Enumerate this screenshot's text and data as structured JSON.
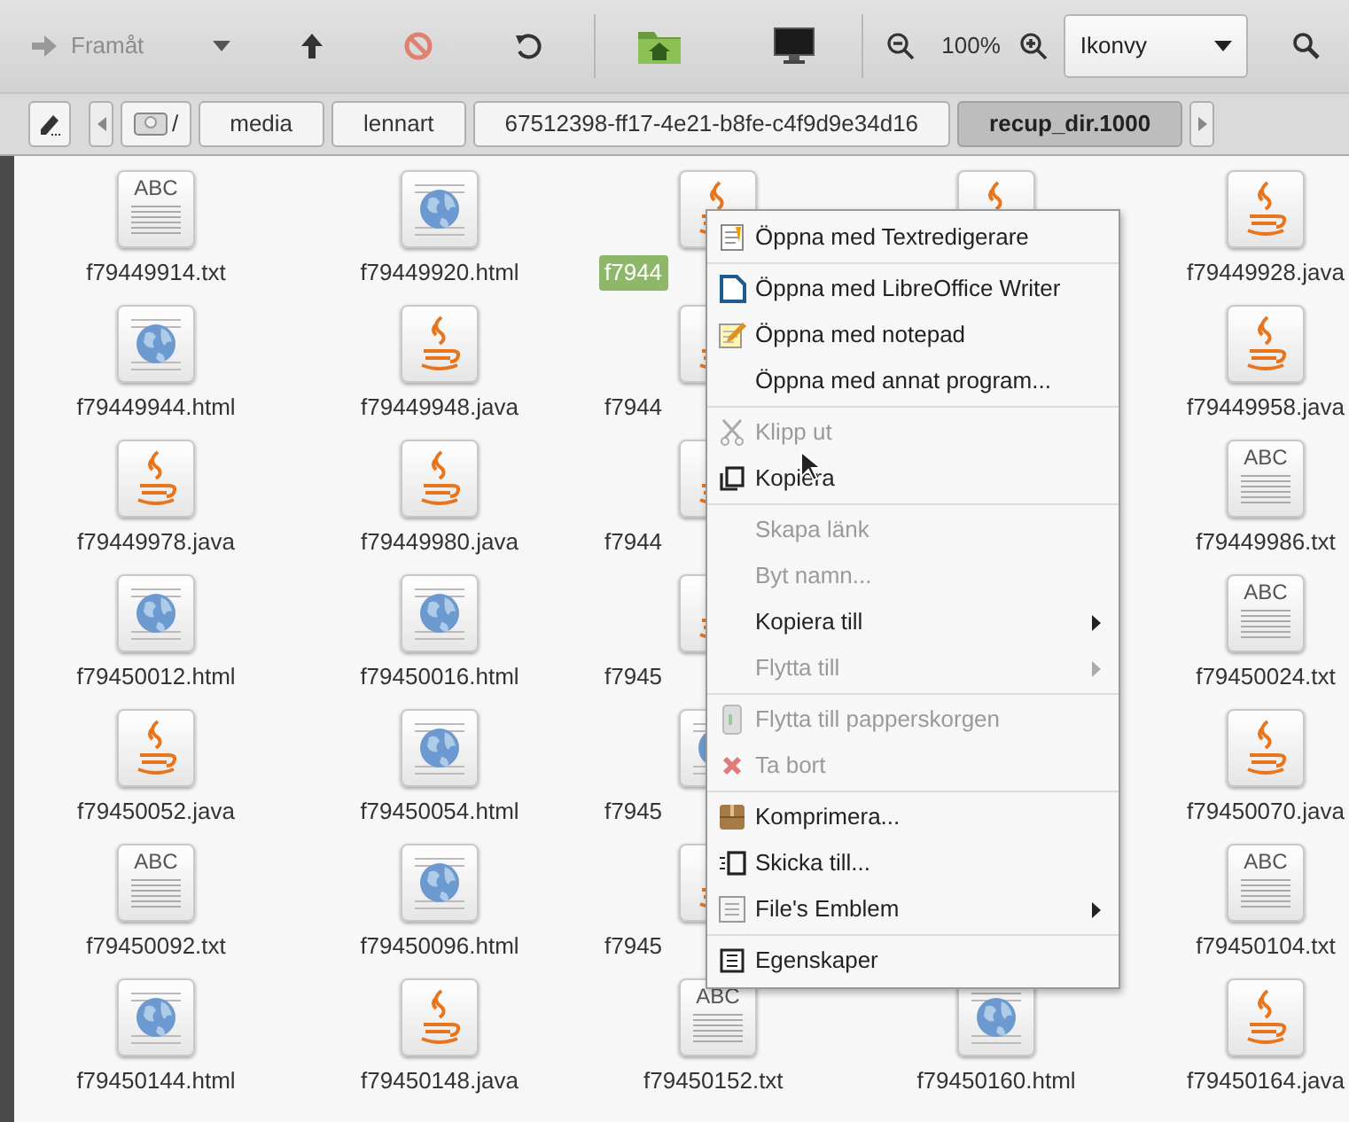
{
  "toolbar": {
    "forward": {
      "label": "Framåt",
      "disabled": true
    },
    "zoom_level": "100%",
    "view_select": {
      "value": "Ikonvy"
    }
  },
  "path_bar": {
    "root": "/",
    "segments": [
      {
        "label": "media",
        "selected": false
      },
      {
        "label": "lennart",
        "selected": false
      },
      {
        "label": "67512398-ff17-4e21-b8fe-c4f9d9e34d16",
        "selected": false
      },
      {
        "label": "recup_dir.1000",
        "selected": true
      }
    ]
  },
  "files": [
    [
      {
        "kind": "txt",
        "icon_text": "ABC",
        "label": "f79449914.txt",
        "selected": false
      },
      {
        "kind": "html",
        "label": "f79449920.html",
        "selected": false
      },
      {
        "kind": "java",
        "label": "f7944",
        "selected": true
      },
      {
        "kind": "java"
      },
      {
        "kind": "java",
        "label": "f79449928.java",
        "selected": false
      }
    ],
    [
      {
        "kind": "html",
        "label": "f79449944.html",
        "selected": false
      },
      {
        "kind": "java",
        "label": "f79449948.java",
        "selected": false
      },
      {
        "kind": "java",
        "label": "f7944",
        "selected": false
      },
      {
        "kind": "java",
        "label": "f79449958.java",
        "selected": false
      }
    ],
    [
      {
        "kind": "java",
        "label": "f79449978.java",
        "selected": false
      },
      {
        "kind": "java",
        "label": "f79449980.java",
        "selected": false
      },
      {
        "kind": "java",
        "label": "f7944",
        "selected": false
      },
      {
        "kind": "txt",
        "icon_text": "ABC",
        "label": "f79449986.txt",
        "selected": false
      }
    ],
    [
      {
        "kind": "html",
        "label": "f79450012.html",
        "selected": false
      },
      {
        "kind": "html",
        "label": "f79450016.html",
        "selected": false
      },
      {
        "kind": "java",
        "label": "f7945",
        "selected": false
      },
      {
        "kind": "txt",
        "icon_text": "ABC",
        "label": "f79450024.txt",
        "selected": false
      }
    ],
    [
      {
        "kind": "java",
        "label": "f79450052.java",
        "selected": false
      },
      {
        "kind": "html",
        "label": "f79450054.html",
        "selected": false
      },
      {
        "kind": "html",
        "label": "f7945",
        "selected": false
      },
      {
        "kind": "java",
        "label": "f79450070.java",
        "selected": false
      }
    ],
    [
      {
        "kind": "txt",
        "icon_text": "ABC",
        "label": "f79450092.txt",
        "selected": false
      },
      {
        "kind": "html",
        "label": "f79450096.html",
        "selected": false
      },
      {
        "kind": "java",
        "label": "f7945",
        "selected": false
      },
      {
        "kind": "txt",
        "icon_text": "ABC",
        "label": "f79450104.txt",
        "selected": false
      }
    ],
    [
      {
        "kind": "html",
        "label": "f79450144.html",
        "selected": false
      },
      {
        "kind": "java",
        "label": "f79450148.java",
        "selected": false
      },
      {
        "kind": "txt",
        "icon_text": "ABC",
        "label": "f79450152.txt",
        "selected": false
      },
      {
        "kind": "html",
        "label": "f79450160.html",
        "selected": false
      },
      {
        "kind": "java",
        "label": "f79450164.java",
        "selected": false
      }
    ]
  ],
  "context_menu": [
    {
      "kind": "editor",
      "label": "Öppna med Textredigerare",
      "disabled": false,
      "submenu": false
    },
    {
      "kind": "separator"
    },
    {
      "kind": "writer",
      "label": "Öppna med LibreOffice Writer",
      "disabled": false,
      "submenu": false
    },
    {
      "kind": "notepad",
      "label": "Öppna med notepad",
      "disabled": false,
      "submenu": false
    },
    {
      "kind": "plain",
      "label": "Öppna med annat program...",
      "disabled": false,
      "submenu": false
    },
    {
      "kind": "separator"
    },
    {
      "kind": "cut",
      "label": "Klipp ut",
      "disabled": true,
      "submenu": false
    },
    {
      "kind": "copy",
      "label": "Kopiera",
      "disabled": false,
      "submenu": false
    },
    {
      "kind": "separator"
    },
    {
      "kind": "plain",
      "label": "Skapa länk",
      "disabled": true,
      "submenu": false
    },
    {
      "kind": "plain",
      "label": "Byt namn...",
      "disabled": true,
      "submenu": false
    },
    {
      "kind": "plain",
      "label": "Kopiera till",
      "disabled": false,
      "submenu": true
    },
    {
      "kind": "plain",
      "label": "Flytta till",
      "disabled": true,
      "submenu": true
    },
    {
      "kind": "separator"
    },
    {
      "kind": "trash",
      "label": "Flytta till papperskorgen",
      "disabled": true,
      "submenu": false
    },
    {
      "kind": "delete",
      "label": "Ta bort",
      "disabled": true,
      "submenu": false
    },
    {
      "kind": "separator"
    },
    {
      "kind": "archive",
      "label": "Komprimera...",
      "disabled": false,
      "submenu": false
    },
    {
      "kind": "send",
      "label": "Skicka till...",
      "disabled": false,
      "submenu": false
    },
    {
      "kind": "emblem",
      "label": "File's Emblem",
      "disabled": false,
      "submenu": true
    },
    {
      "kind": "separator"
    },
    {
      "kind": "properties",
      "label": "Egenskaper",
      "disabled": false,
      "submenu": false
    }
  ]
}
